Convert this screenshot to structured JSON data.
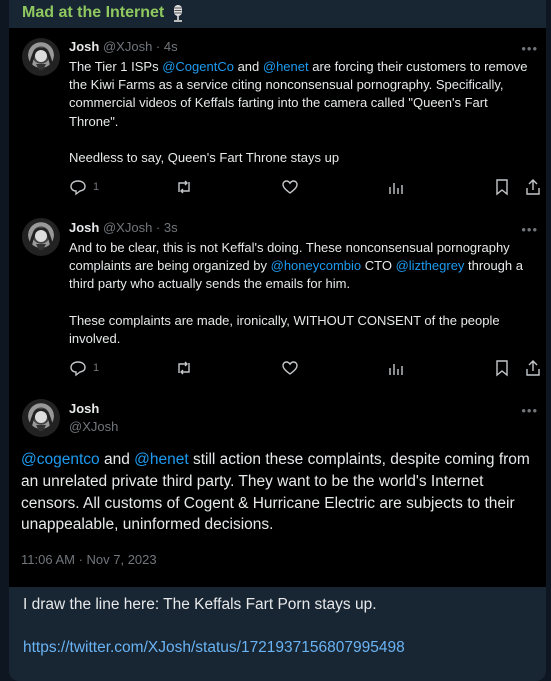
{
  "channel": {
    "title": "Mad at the Internet"
  },
  "tweets": [
    {
      "name": "Josh",
      "handle": "@XJosh",
      "time": "· 4s",
      "text_a": "The Tier 1 ISPs ",
      "mention_1": "@CogentCo",
      "text_b": " and ",
      "mention_2": "@henet",
      "text_c": " are forcing their customers to remove the Kiwi Farms as a service citing nonconsensual pornography. Specifically, commercial videos of Keffals farting into the camera called \"Queen's Fart Throne\".",
      "para2": "Needless to say, Queen's Fart Throne stays up",
      "reply_count": "1"
    },
    {
      "name": "Josh",
      "handle": "@XJosh",
      "time": "· 3s",
      "text_a": "And to be clear, this is not Keffal's doing. These nonconsensual pornography complaints are being organized by ",
      "mention_1": "@honeycombio",
      "text_b": " CTO ",
      "mention_2": "@lizthegrey",
      "text_c": " through a third party who actually sends the emails for him.",
      "para2": "These complaints are made, ironically, WITHOUT CONSENT of the people involved.",
      "reply_count": "1"
    }
  ],
  "main_tweet": {
    "name": "Josh",
    "handle": "@XJosh",
    "mention_1": "@cogentco",
    "text_a": " and ",
    "mention_2": "@henet",
    "text_b": " still action these complaints, despite coming from an unrelated private third party. They want to be the world's Internet censors.  All customs of Cogent & Hurricane Electric are subjects to their unappealable, uninformed decisions.",
    "timestamp": "11:06 AM · Nov 7, 2023"
  },
  "message": {
    "caption": "I draw the line here: The Keffals Fart Porn stays up.",
    "link": "https://twitter.com/XJosh/status/1721937156807995498"
  },
  "colors": {
    "mention": "#1d9bf0",
    "channel_title": "#8fc85f",
    "link": "#6ab3f3"
  },
  "icons": [
    "microphone-icon",
    "more-icon",
    "reply-icon",
    "retweet-icon",
    "like-icon",
    "views-icon",
    "bookmark-icon",
    "share-icon"
  ]
}
